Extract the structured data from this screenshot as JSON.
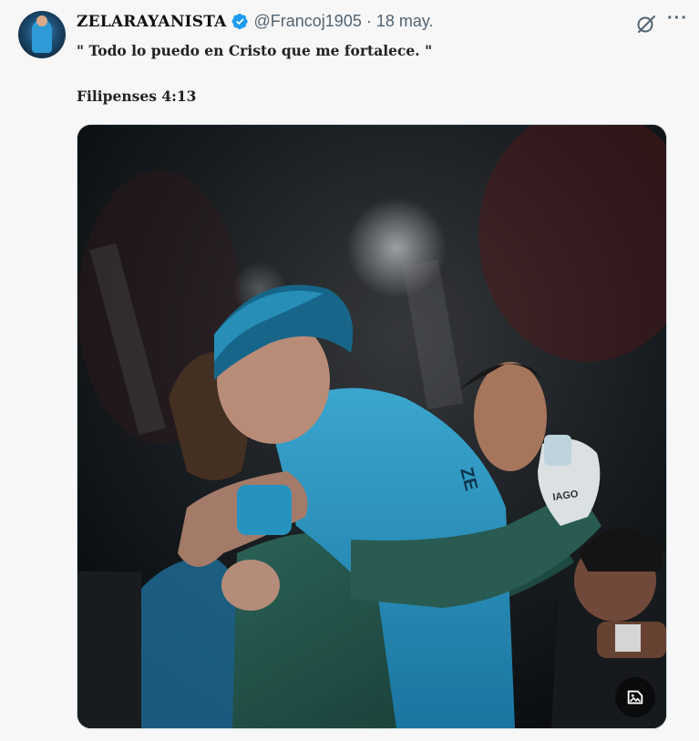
{
  "author": {
    "display_name": "ZELARAYANISTA",
    "handle": "@Francoj1905",
    "separator": "·",
    "date": "18 may.",
    "verified": true
  },
  "tweet": {
    "text": "\" Todo lo puedo en Cristo que me fortalece. \"",
    "reference": "Filipenses 4:13"
  },
  "media": {
    "jersey_text_sleeve": "ZE",
    "glove_text": "IAGO"
  },
  "icons": {
    "verified": "verified-badge-icon",
    "grok": "grok-icon",
    "more": "more-icon",
    "media_badge": "image-tag-icon"
  },
  "colors": {
    "verified": "#1d9bf0",
    "muted_text": "#536471",
    "background": "#f7f7f8"
  }
}
